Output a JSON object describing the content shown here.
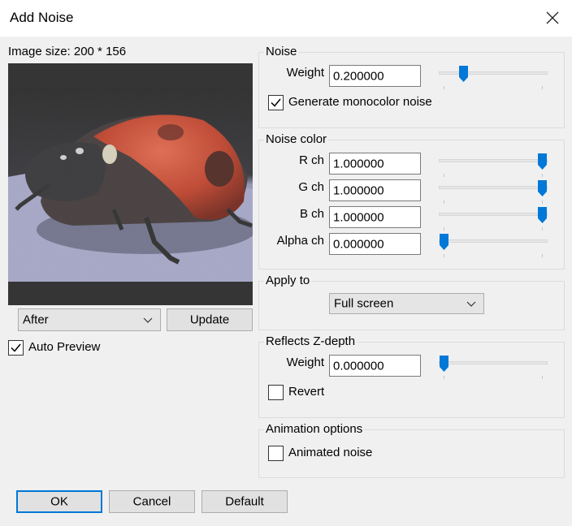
{
  "window": {
    "title": "Add Noise"
  },
  "preview": {
    "image_size_label": "Image size: 200 * 156",
    "view_mode": "After",
    "update_label": "Update",
    "auto_preview_label": "Auto Preview",
    "auto_preview_checked": true
  },
  "noise": {
    "group_label": "Noise",
    "weight_label": "Weight",
    "weight_value": "0.200000",
    "weight_level": 0.2,
    "monocolor_label": "Generate monocolor noise",
    "monocolor_checked": true
  },
  "noise_color": {
    "group_label": "Noise color",
    "channels": [
      {
        "label": "R ch",
        "value": "1.000000",
        "level": 1.0
      },
      {
        "label": "G ch",
        "value": "1.000000",
        "level": 1.0
      },
      {
        "label": "B ch",
        "value": "1.000000",
        "level": 1.0
      },
      {
        "label": "Alpha ch",
        "value": "0.000000",
        "level": 0.0
      }
    ]
  },
  "apply_to": {
    "group_label": "Apply to",
    "selected": "Full screen"
  },
  "z_depth": {
    "group_label": "Reflects Z-depth",
    "weight_label": "Weight",
    "weight_value": "0.000000",
    "weight_level": 0.0,
    "revert_label": "Revert",
    "revert_checked": false
  },
  "animation": {
    "group_label": "Animation options",
    "animated_label": "Animated noise",
    "animated_checked": false
  },
  "footer": {
    "ok_label": "OK",
    "cancel_label": "Cancel",
    "default_label": "Default"
  },
  "colors": {
    "accent": "#0078d7",
    "ladybug_red": "#d33a1e",
    "preview_bar": "#353535"
  }
}
